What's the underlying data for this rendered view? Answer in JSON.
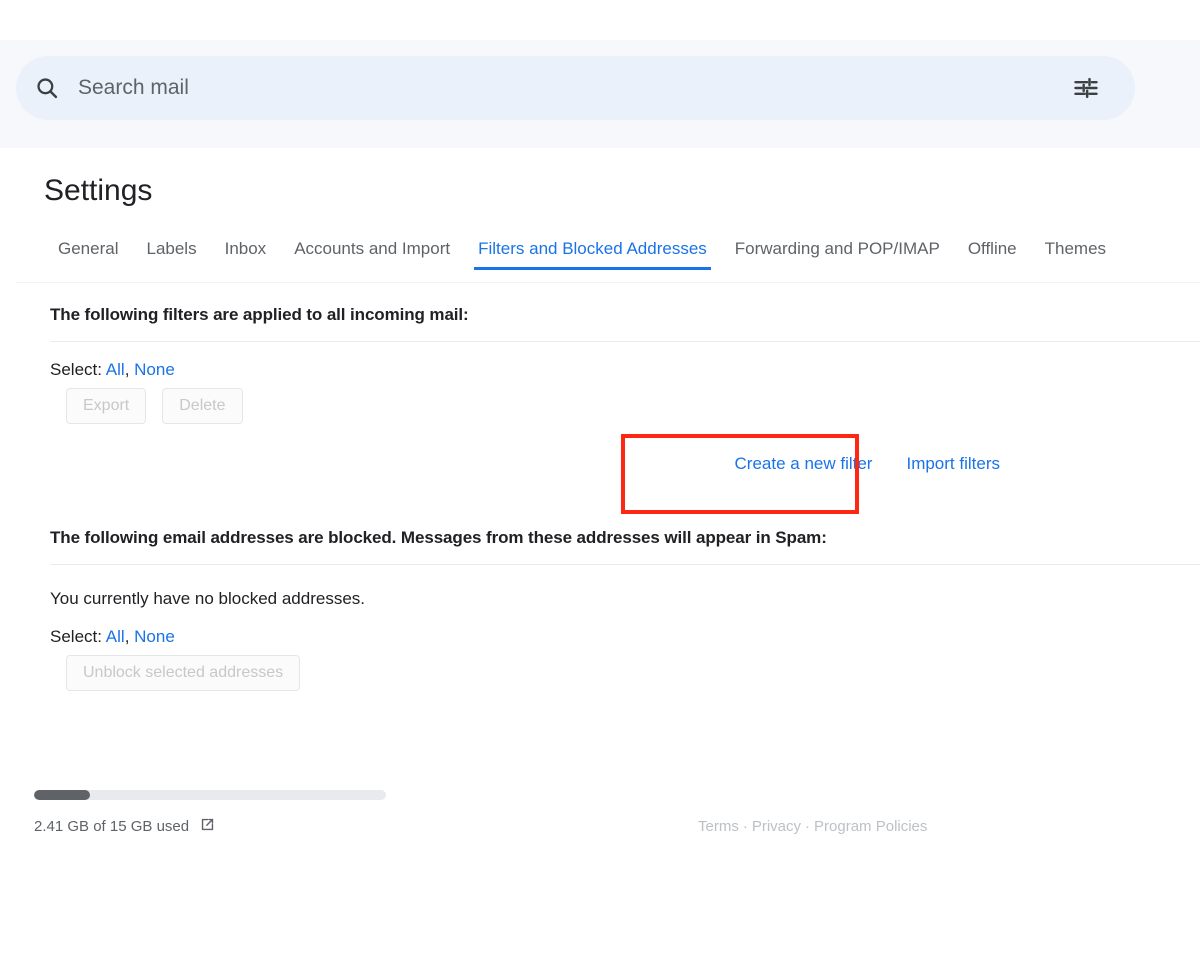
{
  "search": {
    "placeholder": "Search mail",
    "value": "",
    "search_icon": "search-icon",
    "tune_icon": "tune-icon"
  },
  "page": {
    "title": "Settings"
  },
  "tabs": [
    {
      "label": "General",
      "active": false
    },
    {
      "label": "Labels",
      "active": false
    },
    {
      "label": "Inbox",
      "active": false
    },
    {
      "label": "Accounts and Import",
      "active": false
    },
    {
      "label": "Filters and Blocked Addresses",
      "active": true
    },
    {
      "label": "Forwarding and POP/IMAP",
      "active": false
    },
    {
      "label": "Offline",
      "active": false
    },
    {
      "label": "Themes",
      "active": false
    }
  ],
  "filters_section": {
    "heading": "The following filters are applied to all incoming mail:",
    "select_label": "Select:",
    "select_all": "All",
    "select_comma": ",",
    "select_none": "None",
    "export_button": "Export",
    "delete_button": "Delete",
    "create_filter_link": "Create a new filter",
    "import_filters_link": "Import filters"
  },
  "blocked_section": {
    "heading": "The following email addresses are blocked. Messages from these addresses will appear in Spam:",
    "empty_text": "You currently have no blocked addresses.",
    "select_label": "Select:",
    "select_all": "All",
    "select_comma": ",",
    "select_none": "None",
    "unblock_button": "Unblock selected addresses"
  },
  "footer": {
    "storage_text": "2.41 GB of 15 GB used",
    "storage_used_gb": 2.41,
    "storage_total_gb": 15,
    "storage_percent": 16,
    "external_link_icon": "external-link-icon",
    "terms": "Terms",
    "privacy": "Privacy",
    "program_policies": "Program Policies",
    "separator": "·"
  },
  "colors": {
    "accent_blue": "#1a73e8",
    "highlight_red": "#fe2712",
    "search_band": "#f6f8fc",
    "search_pill": "#eaf1fb"
  }
}
